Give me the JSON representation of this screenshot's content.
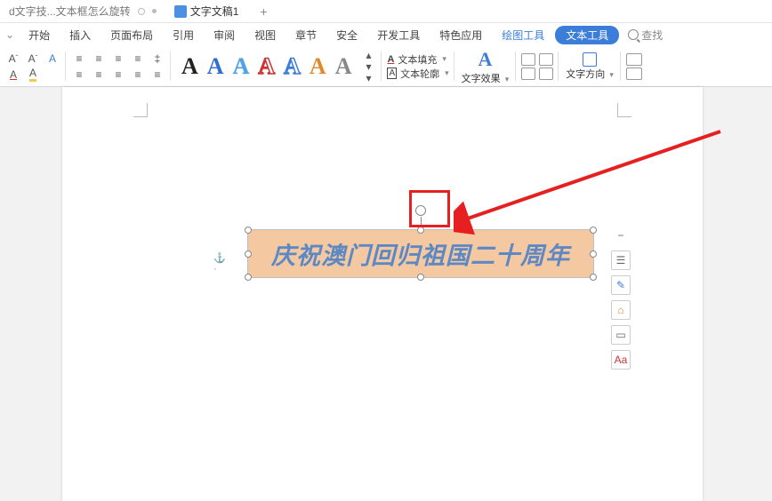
{
  "tabs": {
    "doc1_label": "d文字技...文本框怎么旋转",
    "doc2_label": "文字文稿1",
    "add_label": "+"
  },
  "menu": {
    "items": [
      "开始",
      "插入",
      "页面布局",
      "引用",
      "审阅",
      "视图",
      "章节",
      "安全",
      "开发工具",
      "特色应用",
      "绘图工具",
      "文本工具"
    ],
    "search_placeholder": "查找"
  },
  "ribbon": {
    "font_group_btns": [
      "A",
      "A",
      "A"
    ],
    "art_letters": [
      "A",
      "A",
      "A",
      "A",
      "A",
      "A",
      "A"
    ],
    "text_fill": "文本填充",
    "text_outline": "文本轮廓",
    "text_effect": "文字效果",
    "text_direction": "文字方向",
    "big_A": "A"
  },
  "document": {
    "textbox_content": "庆祝澳门回归祖国二十周年"
  },
  "float_tools": {
    "minus": "−",
    "outline": "☰",
    "pen": "✎",
    "home": "⌂",
    "rect": "▭",
    "abc": "Aa"
  }
}
